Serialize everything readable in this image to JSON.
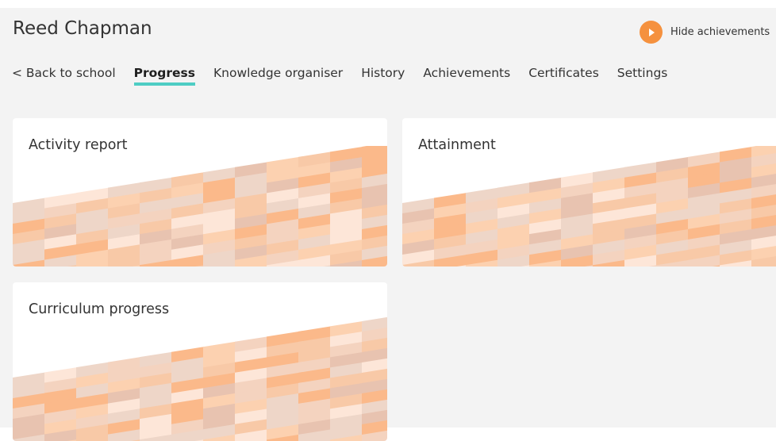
{
  "header": {
    "student_name": "Reed Chapman",
    "hide_achievements_label": "Hide achievements"
  },
  "nav": {
    "items": [
      {
        "label": "< Back to school",
        "active": false
      },
      {
        "label": "Progress",
        "active": true
      },
      {
        "label": "Knowledge organiser",
        "active": false
      },
      {
        "label": "History",
        "active": false
      },
      {
        "label": "Achievements",
        "active": false
      },
      {
        "label": "Certificates",
        "active": false
      },
      {
        "label": "Settings",
        "active": false
      }
    ]
  },
  "cards": [
    {
      "title": "Activity report"
    },
    {
      "title": "Attainment"
    },
    {
      "title": "Curriculum progress"
    }
  ],
  "colors": {
    "accent_orange": "#f5913e",
    "active_tab_underline": "#4ecdc4",
    "pattern_palette": [
      "#fbb98a",
      "#f8c9a7",
      "#f4d3bf",
      "#eed6c8",
      "#fde6d8",
      "#e8c3b0",
      "#fcd1b0"
    ]
  },
  "icons": {
    "hide_achievements": "play-circle-icon"
  }
}
